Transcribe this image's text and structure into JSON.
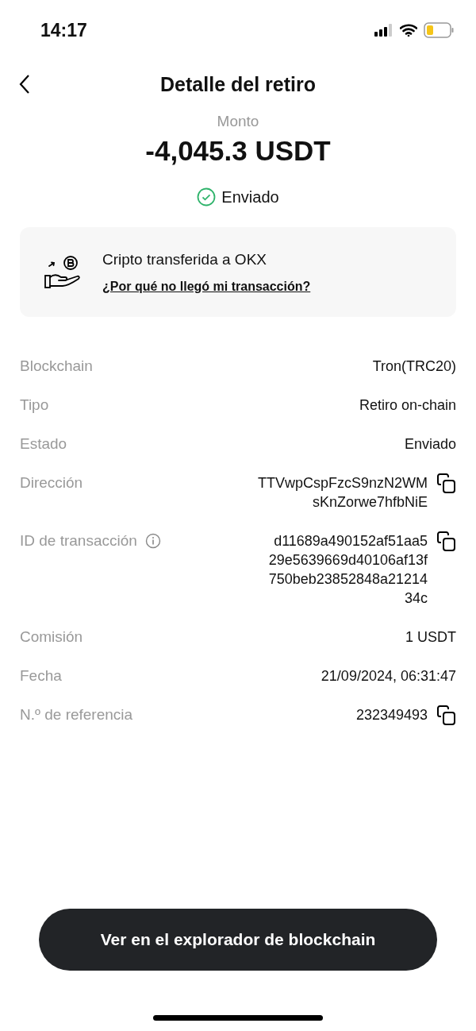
{
  "status_bar": {
    "time": "14:17"
  },
  "header": {
    "title": "Detalle del retiro"
  },
  "amount": {
    "label": "Monto",
    "value": "-4,045.3 USDT"
  },
  "status": {
    "label": "Enviado"
  },
  "notice": {
    "title": "Cripto transferida a OKX",
    "link": "¿Por qué no llegó mi transacción?"
  },
  "details": [
    {
      "label": "Blockchain",
      "value": [
        "Tron(TRC20)"
      ],
      "info": false,
      "copyable": false
    },
    {
      "label": "Tipo",
      "value": [
        "Retiro on-chain"
      ],
      "info": false,
      "copyable": false
    },
    {
      "label": "Estado",
      "value": [
        "Enviado"
      ],
      "info": false,
      "copyable": false
    },
    {
      "label": "Dirección",
      "value": [
        "TTVwpCspFzcS9nzN2WM",
        "sKnZorwe7hfbNiE"
      ],
      "info": false,
      "copyable": true
    },
    {
      "label": "ID de transacción",
      "value": [
        "d11689a490152af51aa5",
        "29e5639669d40106af13f",
        "750beb23852848a21214",
        "34c"
      ],
      "info": true,
      "copyable": true
    },
    {
      "label": "Comisión",
      "value": [
        "1 USDT"
      ],
      "info": false,
      "copyable": false
    },
    {
      "label": "Fecha",
      "value": [
        "21/09/2024, 06:31:47"
      ],
      "info": false,
      "copyable": false
    },
    {
      "label": "N.º de referencia",
      "value": [
        "232349493"
      ],
      "info": false,
      "copyable": true
    }
  ],
  "action_button": {
    "label": "Ver en el explorador de blockchain"
  }
}
